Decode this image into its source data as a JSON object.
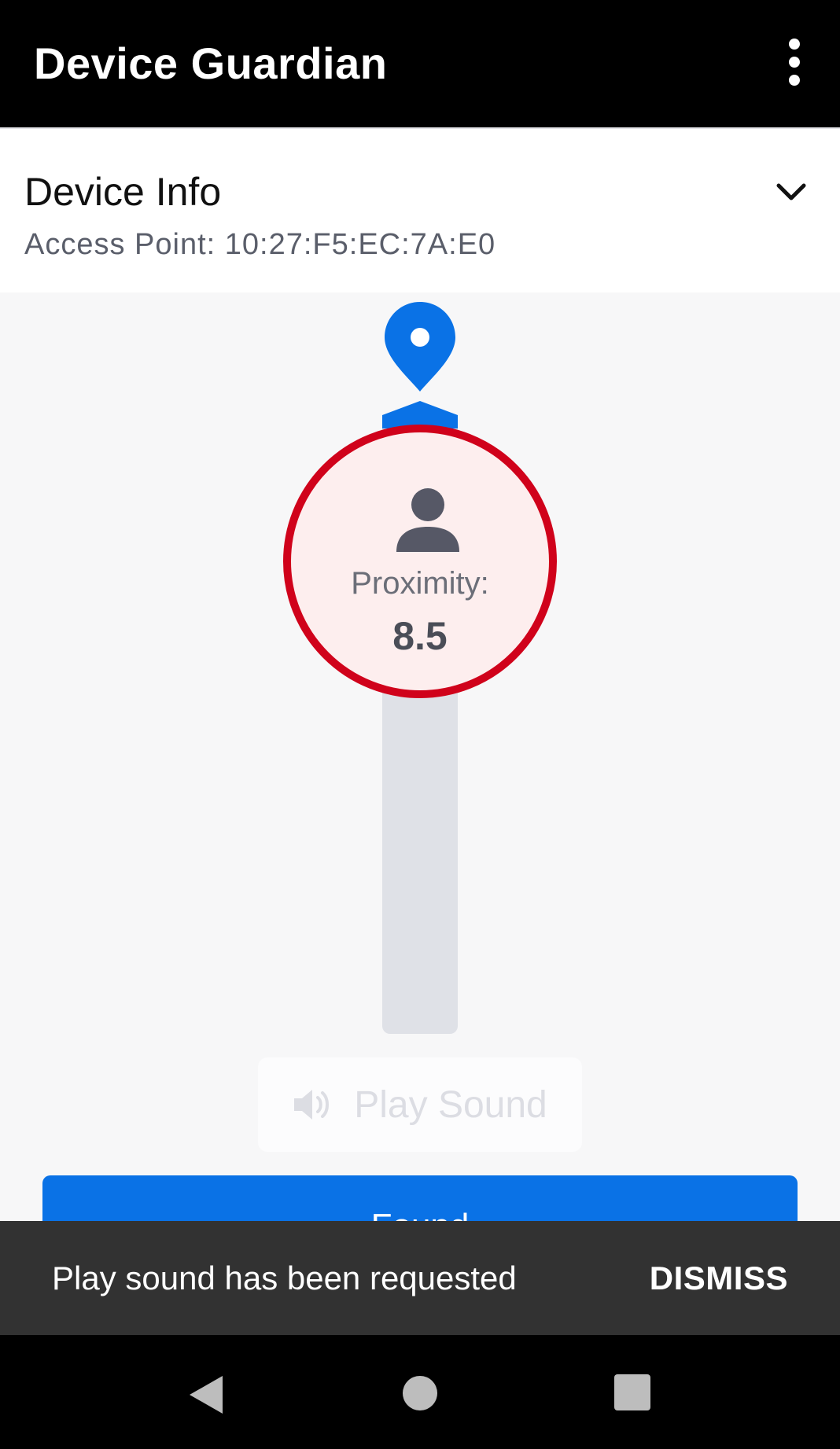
{
  "app_bar": {
    "title": "Device Guardian",
    "overflow_icon": "more-vert-icon"
  },
  "device_info": {
    "title": "Device Info",
    "access_point": "Access Point: 10:27:F5:EC:7A:E0",
    "expand_icon": "chevron-down-icon"
  },
  "proximity": {
    "label": "Proximity:",
    "value": "8.5",
    "ring_color": "#d0021b",
    "pin_color": "#0a72e6",
    "icon": "person-icon"
  },
  "play_sound": {
    "label": "Play Sound",
    "icon": "speaker-icon",
    "state": "disabled"
  },
  "primary_button": {
    "label": "Found",
    "color": "#0a72e6"
  },
  "snackbar": {
    "message": "Play sound has been requested",
    "action": "DISMISS"
  },
  "nav": {
    "back_icon": "back-triangle-icon",
    "home_icon": "home-circle-icon",
    "recents_icon": "recents-square-icon"
  }
}
